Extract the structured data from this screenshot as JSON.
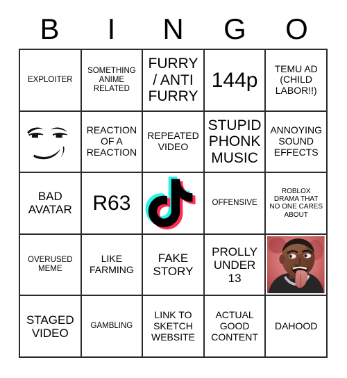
{
  "header": {
    "letters": [
      "B",
      "I",
      "N",
      "G",
      "O"
    ]
  },
  "grid": {
    "rows": 5,
    "columns": 5,
    "border_color": "#2b2b2b",
    "background_color": "#ffffff",
    "text_color": "#000000"
  },
  "cells": [
    {
      "id": "b1",
      "type": "text",
      "text": "EXPLOITER",
      "size": "s"
    },
    {
      "id": "i1",
      "type": "text",
      "text": "SOMETHING ANIME RELATED",
      "size": "s"
    },
    {
      "id": "n1",
      "type": "text",
      "text": "FURRY / ANTI FURRY",
      "size": "xl"
    },
    {
      "id": "g1",
      "type": "text",
      "text": "144p",
      "size": "xxl"
    },
    {
      "id": "o1",
      "type": "text",
      "text": "TEMU AD (CHILD LABOR!!)",
      "size": "m"
    },
    {
      "id": "b2",
      "type": "image",
      "image": "roblox-man-face",
      "alt": "Roblox man face meme"
    },
    {
      "id": "i2",
      "type": "text",
      "text": "REACTION OF A REACTION",
      "size": "m"
    },
    {
      "id": "n2",
      "type": "text",
      "text": "REPEATED VIDEO",
      "size": "m"
    },
    {
      "id": "g2",
      "type": "text",
      "text": "STUPID PHONK MUSIC",
      "size": "xl"
    },
    {
      "id": "o2",
      "type": "text",
      "text": "ANNOYING SOUND EFFECTS",
      "size": "m"
    },
    {
      "id": "b3",
      "type": "text",
      "text": "BAD AVATAR",
      "size": "l"
    },
    {
      "id": "i3",
      "type": "text",
      "text": "R63",
      "size": "xxl"
    },
    {
      "id": "n3",
      "type": "image",
      "image": "tiktok-logo",
      "alt": "TikTok logo"
    },
    {
      "id": "g3",
      "type": "text",
      "text": "OFFENSIVE",
      "size": "s"
    },
    {
      "id": "o3",
      "type": "text",
      "text": "ROBLOX DRAMA THAT NO ONE CARES ABOUT",
      "size": "xs"
    },
    {
      "id": "b4",
      "type": "text",
      "text": "OVERUSED MEME",
      "size": "s"
    },
    {
      "id": "i4",
      "type": "text",
      "text": "LIKE FARMING",
      "size": "m"
    },
    {
      "id": "n4",
      "type": "text",
      "text": "FAKE STORY",
      "size": "l"
    },
    {
      "id": "g4",
      "type": "text",
      "text": "PROLLY UNDER 13",
      "size": "l"
    },
    {
      "id": "o4",
      "type": "image",
      "image": "tongue-out-man-photo",
      "alt": "Photo of a man with his tongue out on a red background"
    },
    {
      "id": "b5",
      "type": "text",
      "text": "STAGED VIDEO",
      "size": "l"
    },
    {
      "id": "i5",
      "type": "text",
      "text": "GAMBLING",
      "size": "s"
    },
    {
      "id": "n5",
      "type": "text",
      "text": "LINK TO SKETCH WEBSITE",
      "size": "m"
    },
    {
      "id": "g5",
      "type": "text",
      "text": "ACTUAL GOOD CONTENT",
      "size": "m"
    },
    {
      "id": "o5",
      "type": "text",
      "text": "DAHOOD",
      "size": "m"
    }
  ],
  "colors": {
    "tiktok_cyan": "#25f4ee",
    "tiktok_pink": "#fe2c55",
    "tiktok_black": "#000000",
    "photo_background_red": "#c94a4a",
    "skin_tone": "#7a4a33"
  }
}
